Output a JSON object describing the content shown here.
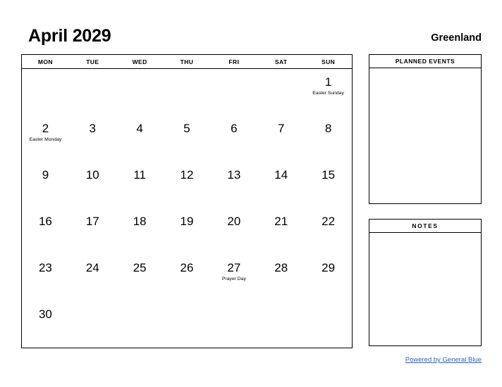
{
  "header": {
    "title": "April 2029",
    "region": "Greenland"
  },
  "calendar": {
    "day_headers": [
      "MON",
      "TUE",
      "WED",
      "THU",
      "FRI",
      "SAT",
      "SUN"
    ],
    "weeks": [
      [
        {
          "day": "",
          "event": ""
        },
        {
          "day": "",
          "event": ""
        },
        {
          "day": "",
          "event": ""
        },
        {
          "day": "",
          "event": ""
        },
        {
          "day": "",
          "event": ""
        },
        {
          "day": "",
          "event": ""
        },
        {
          "day": "1",
          "event": "Easter Sunday"
        }
      ],
      [
        {
          "day": "2",
          "event": "Easter Monday"
        },
        {
          "day": "3",
          "event": ""
        },
        {
          "day": "4",
          "event": ""
        },
        {
          "day": "5",
          "event": ""
        },
        {
          "day": "6",
          "event": ""
        },
        {
          "day": "7",
          "event": ""
        },
        {
          "day": "8",
          "event": ""
        }
      ],
      [
        {
          "day": "9",
          "event": ""
        },
        {
          "day": "10",
          "event": ""
        },
        {
          "day": "11",
          "event": ""
        },
        {
          "day": "12",
          "event": ""
        },
        {
          "day": "13",
          "event": ""
        },
        {
          "day": "14",
          "event": ""
        },
        {
          "day": "15",
          "event": ""
        }
      ],
      [
        {
          "day": "16",
          "event": ""
        },
        {
          "day": "17",
          "event": ""
        },
        {
          "day": "18",
          "event": ""
        },
        {
          "day": "19",
          "event": ""
        },
        {
          "day": "20",
          "event": ""
        },
        {
          "day": "21",
          "event": ""
        },
        {
          "day": "22",
          "event": ""
        }
      ],
      [
        {
          "day": "23",
          "event": ""
        },
        {
          "day": "24",
          "event": ""
        },
        {
          "day": "25",
          "event": ""
        },
        {
          "day": "26",
          "event": ""
        },
        {
          "day": "27",
          "event": "Prayer Day"
        },
        {
          "day": "28",
          "event": ""
        },
        {
          "day": "29",
          "event": ""
        }
      ],
      [
        {
          "day": "30",
          "event": ""
        },
        {
          "day": "",
          "event": ""
        },
        {
          "day": "",
          "event": ""
        },
        {
          "day": "",
          "event": ""
        },
        {
          "day": "",
          "event": ""
        },
        {
          "day": "",
          "event": ""
        },
        {
          "day": "",
          "event": ""
        }
      ]
    ]
  },
  "panels": {
    "planned_events": {
      "title": "PLANNED EVENTS",
      "content": ""
    },
    "notes": {
      "title": "NOTES",
      "content": ""
    }
  },
  "footer": {
    "link_text": "Powered by General Blue",
    "link_color": "#2563c8"
  }
}
